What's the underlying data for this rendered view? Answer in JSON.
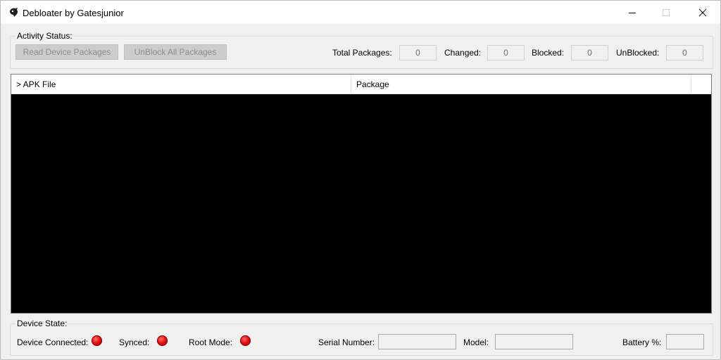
{
  "window": {
    "title": "Debloater by Gatesjunior",
    "colors": {
      "titlebar": "#ffffff",
      "background": "#f0f0f0",
      "list_background": "#000000",
      "led_red": "#e01010"
    }
  },
  "activity": {
    "group_label": "Activity Status:",
    "read_button": "Read Device Packages",
    "unblock_button": "UnBlock All Packages",
    "stats": {
      "total_label": "Total Packages:",
      "total_value": "0",
      "changed_label": "Changed:",
      "changed_value": "0",
      "blocked_label": "Blocked:",
      "blocked_value": "0",
      "unblocked_label": "UnBlocked:",
      "unblocked_value": "0"
    }
  },
  "list": {
    "columns": [
      "> APK File",
      "Package"
    ]
  },
  "device": {
    "group_label": "Device State:",
    "connected_label": "Device Connected:",
    "synced_label": "Synced:",
    "root_label": "Root Mode:",
    "serial_label": "Serial Number:",
    "model_label": "Model:",
    "battery_label": "Battery %:"
  }
}
